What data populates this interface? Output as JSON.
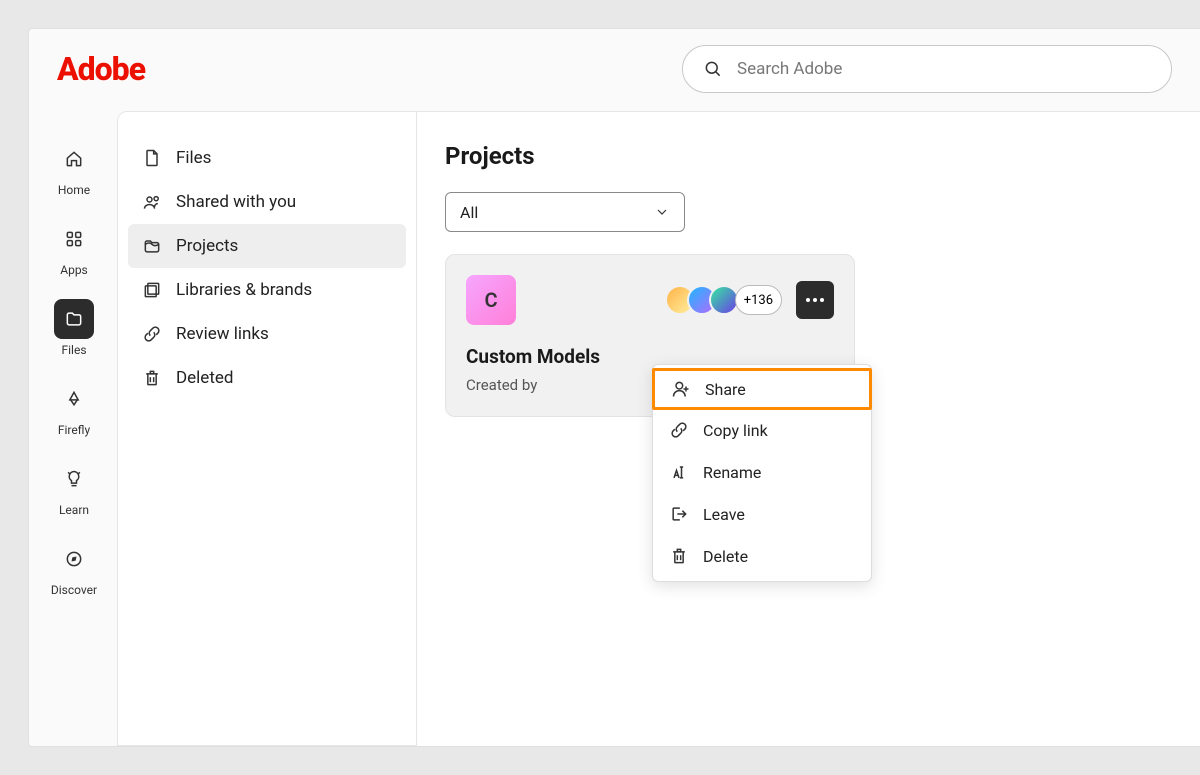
{
  "brand": "Adobe",
  "search": {
    "placeholder": "Search Adobe"
  },
  "rail": {
    "home": "Home",
    "apps": "Apps",
    "files": "Files",
    "firefly": "Firefly",
    "learn": "Learn",
    "discover": "Discover"
  },
  "panel": {
    "files": "Files",
    "shared": "Shared with you",
    "projects": "Projects",
    "libraries": "Libraries & brands",
    "review": "Review links",
    "deleted": "Deleted"
  },
  "main": {
    "title": "Projects",
    "filter": "All",
    "card": {
      "thumb_letter": "C",
      "more_count": "+136",
      "title": "Custom Models",
      "subtitle": "Created by"
    }
  },
  "menu": {
    "share": "Share",
    "copy": "Copy link",
    "rename": "Rename",
    "leave": "Leave",
    "delete": "Delete"
  }
}
